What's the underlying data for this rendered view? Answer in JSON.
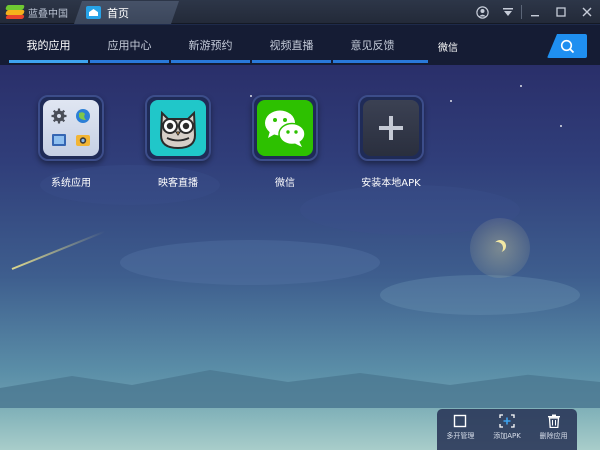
{
  "titlebar": {
    "brand": "蓝叠中国",
    "home_tab": "首页"
  },
  "nav": {
    "tabs": [
      {
        "label": "我的应用"
      },
      {
        "label": "应用中心"
      },
      {
        "label": "新游预约"
      },
      {
        "label": "视频直播"
      },
      {
        "label": "意见反馈"
      }
    ],
    "active_index": 0
  },
  "search": {
    "value": "微信"
  },
  "apps": [
    {
      "label": "系统应用",
      "icon": "folder-icon"
    },
    {
      "label": "映客直播",
      "icon": "owl-icon"
    },
    {
      "label": "微信",
      "icon": "wechat-icon"
    },
    {
      "label": "安装本地APK",
      "icon": "plus-icon"
    }
  ],
  "toolbar": {
    "multi_open": "多开管理",
    "add_apk": "添加APK",
    "delete_app": "删除应用"
  },
  "colors": {
    "accent": "#1f8ff0",
    "tab_underline": "#2979d9",
    "wechat": "#2dc100",
    "owl_bg": "#20c7c9"
  }
}
